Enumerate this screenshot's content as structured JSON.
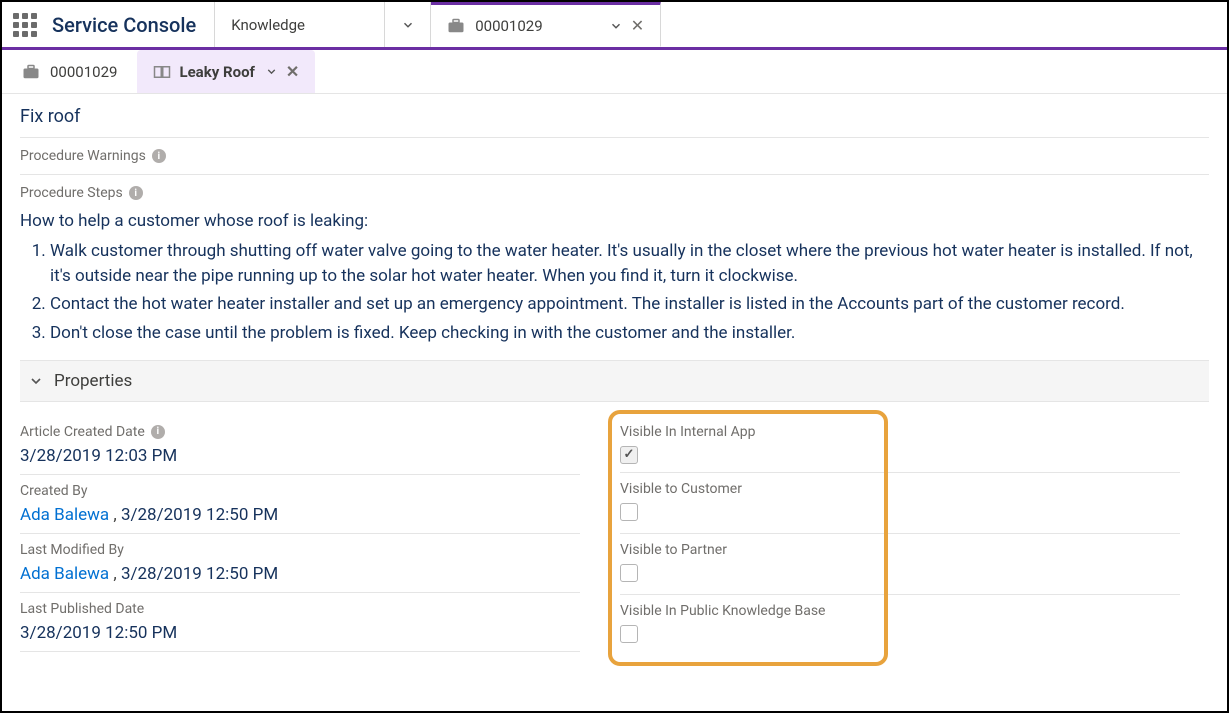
{
  "header": {
    "app_name": "Service Console",
    "nav_knowledge": "Knowledge",
    "nav_case": "00001029"
  },
  "subtabs": {
    "case": "00001029",
    "article": "Leaky Roof"
  },
  "article": {
    "fix_title": "Fix roof",
    "warnings_label": "Procedure Warnings",
    "steps_label": "Procedure Steps",
    "intro": "How to help a customer whose roof is leaking:",
    "steps": [
      "Walk customer through shutting off water valve going to the water heater. It's usually in the closet where the previous hot water heater is installed. If not, it's outside near the pipe running up to the solar hot water heater. When you find it, turn it clockwise.",
      "Contact the hot water heater installer and set up an emergency appointment. The installer is listed in the Accounts part of the customer record.",
      "Don't close the case until the problem is fixed. Keep checking in with the customer and the installer."
    ]
  },
  "properties": {
    "title": "Properties",
    "left": {
      "created_date_label": "Article Created Date",
      "created_date_value": "3/28/2019 12:03 PM",
      "created_by_label": "Created By",
      "created_by_name": "Ada Balewa",
      "created_by_time": "3/28/2019 12:50 PM",
      "modified_by_label": "Last Modified By",
      "modified_by_name": "Ada Balewa",
      "modified_by_time": "3/28/2019 12:50 PM",
      "published_label": "Last Published Date",
      "published_value": "3/28/2019 12:50 PM"
    },
    "right": {
      "internal_label": "Visible In Internal App",
      "internal_checked": true,
      "customer_label": "Visible to Customer",
      "customer_checked": false,
      "partner_label": "Visible to Partner",
      "partner_checked": false,
      "public_label": "Visible In Public Knowledge Base",
      "public_checked": false
    }
  }
}
